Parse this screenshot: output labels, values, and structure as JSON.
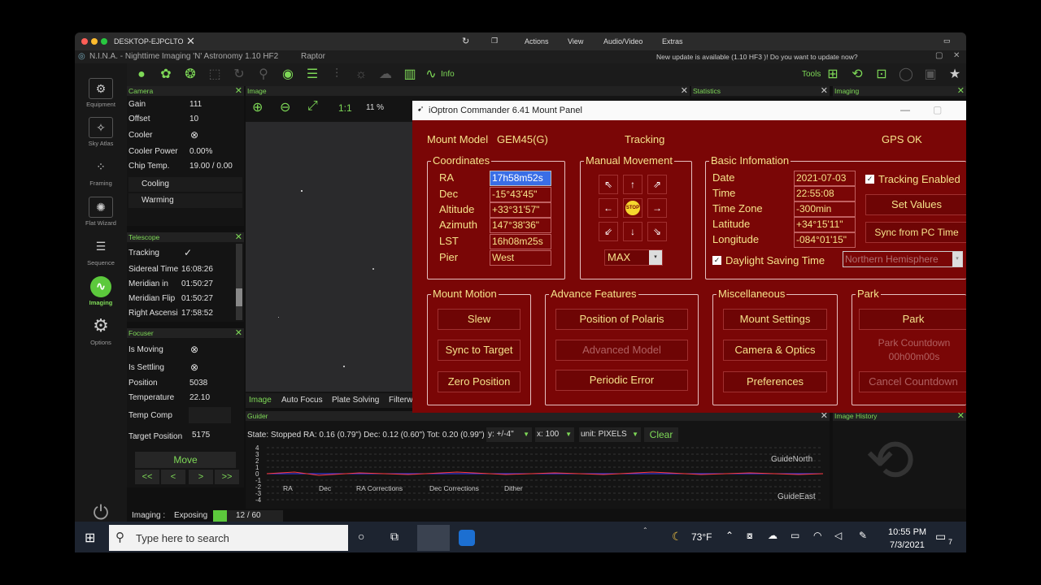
{
  "mac": {
    "host": "DESKTOP-EJPCLTO",
    "actions": "Actions",
    "view": "View",
    "audio": "Audio/Video",
    "extras": "Extras"
  },
  "nina": {
    "title": "N.I.N.A. - Nighttime Imaging 'N' Astronomy 1.10 HF2",
    "profile": "Raptor",
    "update": "New update is available (1.10 HF3 )! Do you want to update now?"
  },
  "toolbar": {
    "info": "Info",
    "tools": "Tools"
  },
  "sidebar": [
    "Equipment",
    "Sky Atlas",
    "Framing",
    "Flat Wizard",
    "Sequence",
    "Imaging",
    "Options"
  ],
  "camera": {
    "title": "Camera",
    "rows": [
      [
        "Gain",
        "111"
      ],
      [
        "Offset",
        "10"
      ],
      [
        "Cooler",
        ""
      ],
      [
        "Cooler Power",
        "0.00%"
      ],
      [
        "Chip Temp.",
        "19.00 /   0.00"
      ]
    ],
    "cooling": "Cooling",
    "warming": "Warming"
  },
  "telescope": {
    "title": "Telescope",
    "rows": [
      [
        "Tracking",
        ""
      ],
      [
        "Sidereal Time",
        "16:08:26"
      ],
      [
        "Meridian in",
        "01:50:27"
      ],
      [
        "Meridian Flip",
        "01:50:27"
      ],
      [
        "Right Ascensi",
        "17:58:52"
      ]
    ]
  },
  "focuser": {
    "title": "Focuser",
    "rows": [
      [
        "Is Moving",
        ""
      ],
      [
        "Is Settling",
        ""
      ],
      [
        "Position",
        "5038"
      ],
      [
        "Temperature",
        "22.10"
      ],
      [
        "Temp Comp",
        ""
      ],
      [
        "Target Position",
        "5175"
      ]
    ],
    "move": "Move",
    "steps": [
      "<<",
      "<",
      ">",
      ">>"
    ]
  },
  "image": {
    "title": "Image",
    "zoom": "11 %",
    "one": "1:1",
    "tabs": [
      "Image",
      "Auto Focus",
      "Plate Solving",
      "Filterw"
    ]
  },
  "stats": {
    "title": "Statistics"
  },
  "imaging": {
    "title": "Imaging"
  },
  "history": {
    "title": "Image History"
  },
  "guider": {
    "title": "Guider",
    "state": "State: Stopped  RA: 0.16 (0.79\")  Dec: 0.12 (0.60\")  Tot: 0.20 (0.99\")",
    "y": "y: +/-4\"",
    "x": "x: 100",
    "unit": "unit: PIXELS",
    "clear": "Clear",
    "yticks": [
      "4",
      "3",
      "2",
      "1",
      "0",
      "-1",
      "-2",
      "-3",
      "-4"
    ],
    "north": "GuideNorth",
    "east": "GuideEast",
    "legend": [
      "RA",
      "Dec",
      "RA Corrections",
      "Dec Corrections",
      "Dither"
    ]
  },
  "status": {
    "label": "Imaging :",
    "exposing": "Exposing",
    "progress": "12 / 60",
    "fraction": 0.2
  },
  "mount": {
    "title": "iOptron Commander 6.41 Mount Panel",
    "model_label": "Mount Model",
    "model": "GEM45(G)",
    "tracking": "Tracking",
    "gps": "GPS OK",
    "coords_title": "Coordinates",
    "coords": [
      [
        "RA",
        "17h58m52s"
      ],
      [
        "Dec",
        "-15°43'45\""
      ],
      [
        "Altitude",
        "+33°31'57\""
      ],
      [
        "Azimuth",
        "147°38'36\""
      ],
      [
        "LST",
        "16h08m25s"
      ],
      [
        "Pier",
        "West"
      ]
    ],
    "manual_title": "Manual Movement",
    "stop": "STOP",
    "speed": "MAX",
    "basic_title": "Basic Infomation",
    "basic": [
      [
        "Date",
        "2021-07-03"
      ],
      [
        "Time",
        "22:55:08"
      ],
      [
        "Time Zone",
        "-300min"
      ],
      [
        "Latitude",
        "+34°15'11\""
      ],
      [
        "Longitude",
        "-084°01'15\""
      ]
    ],
    "tracking_enabled": "Tracking Enabled",
    "set_values": "Set Values",
    "sync_pc": "Sync from PC Time",
    "dst": "Daylight Saving Time",
    "hemisphere": "Northern Hemisphere",
    "motion_title": "Mount Motion",
    "motion": [
      "Slew",
      "Sync to Target",
      "Zero Position"
    ],
    "advance_title": "Advance Features",
    "advance": [
      "Position of Polaris",
      "Advanced Model",
      "Periodic Error"
    ],
    "misc_title": "Miscellaneous",
    "misc": [
      "Mount Settings",
      "Camera & Optics",
      "Preferences"
    ],
    "park_title": "Park",
    "park": "Park",
    "countdown": "Park Countdown",
    "countdown_val": "00h00m00s",
    "cancel": "Cancel Countdown"
  },
  "taskbar": {
    "search": "Type here to search",
    "temp": "73°F",
    "time": "10:55 PM",
    "date": "7/3/2021",
    "notif": "7"
  }
}
